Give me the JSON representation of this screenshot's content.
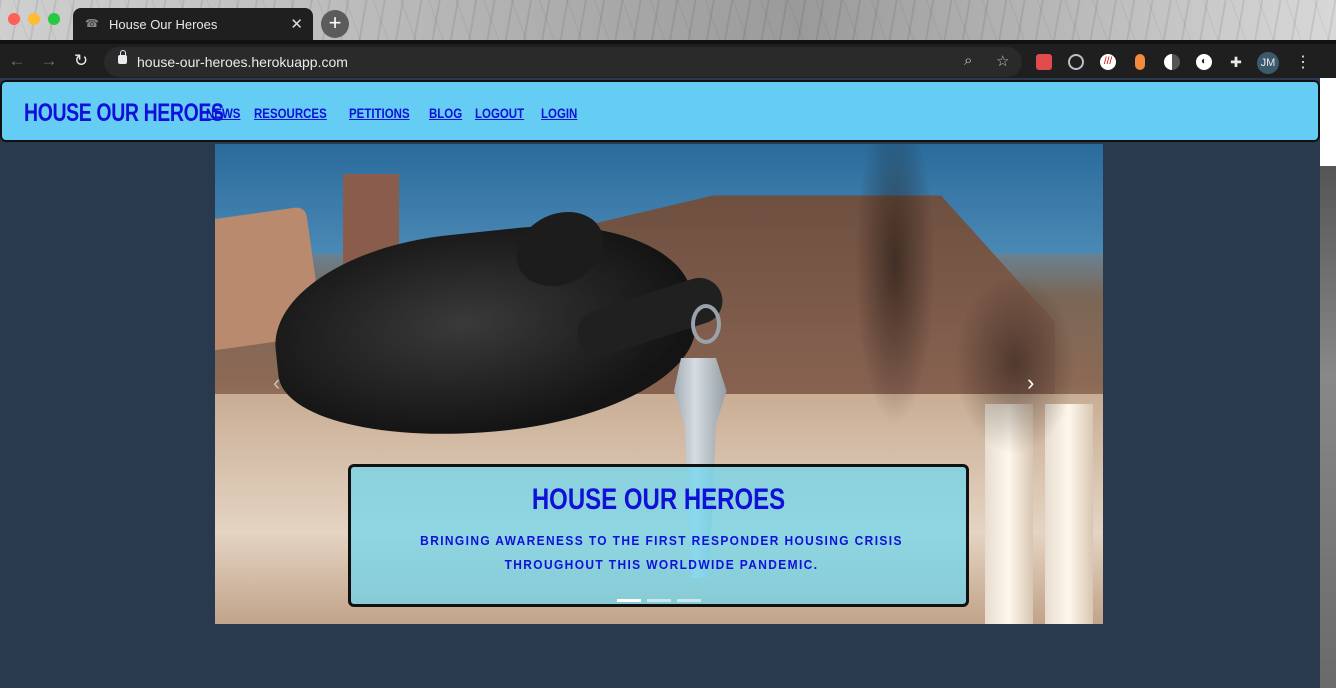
{
  "browser": {
    "tab_title": "House Our Heroes",
    "tab_close": "✕",
    "new_tab": "+",
    "url": "house-our-heroes.herokuapp.com",
    "profile_initials": "JM",
    "extensions": [
      "bookmark-flag-icon",
      "block-icon",
      "marker-icon",
      "orange-bug-icon",
      "contrast-icon",
      "circle-ext-icon",
      "puzzle-icon"
    ]
  },
  "navbar": {
    "brand": "HOUSE OUR HEROES",
    "links": [
      "NEWS",
      "RESOURCES",
      "PETITIONS",
      "BLOG",
      "LOGOUT",
      "LOGIN"
    ]
  },
  "carousel": {
    "prev_icon": "‹",
    "next_icon": "›",
    "caption_title": "HOUSE OUR HEROES",
    "caption_text": "BRINGING AWARENESS TO THE FIRST RESPONDER HOUSING CRISIS THROUGHOUT THIS WORLDWIDE PANDEMIC.",
    "slide_count": 3,
    "active_slide": 1
  },
  "colors": {
    "navbar_bg": "#65cdf4",
    "brand_blue": "#1010d8",
    "page_bg": "#293a4e"
  }
}
